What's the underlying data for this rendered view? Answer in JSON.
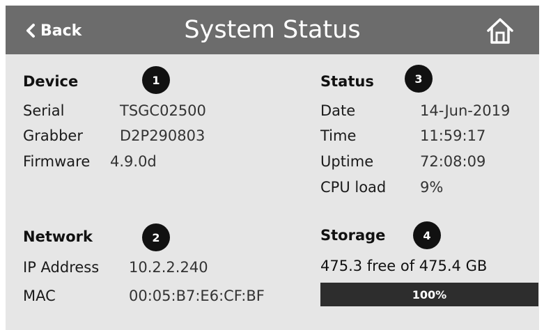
{
  "header": {
    "back_label": "Back",
    "title": "System Status",
    "home_icon": "home-icon",
    "back_icon": "chevron-left-icon"
  },
  "device": {
    "title": "Device",
    "badge": "1",
    "rows": [
      {
        "label": "Serial",
        "value": "TSGC02500"
      },
      {
        "label": "Grabber",
        "value": "D2P290803"
      },
      {
        "label": "Firmware",
        "value": "4.9.0d"
      }
    ]
  },
  "network": {
    "title": "Network",
    "badge": "2",
    "rows": [
      {
        "label": "IP Address",
        "value": "10.2.2.240"
      },
      {
        "label": "MAC",
        "value": "00:05:B7:E6:CF:BF"
      }
    ]
  },
  "status": {
    "title": "Status",
    "badge": "3",
    "rows": [
      {
        "label": "Date",
        "value": "14-Jun-2019"
      },
      {
        "label": "Time",
        "value": "11:59:17"
      },
      {
        "label": "Uptime",
        "value": "72:08:09"
      },
      {
        "label": "CPU load",
        "value": "9%"
      }
    ]
  },
  "storage": {
    "title": "Storage",
    "badge": "4",
    "summary": "475.3 free of 475.4 GB",
    "free_percent": 100,
    "bar_label": "100%"
  },
  "colors": {
    "header_bg": "#6c6c6c",
    "screen_bg": "#e6e6e6",
    "badge_bg": "#111111",
    "bar_bg": "#3c3c3c"
  }
}
